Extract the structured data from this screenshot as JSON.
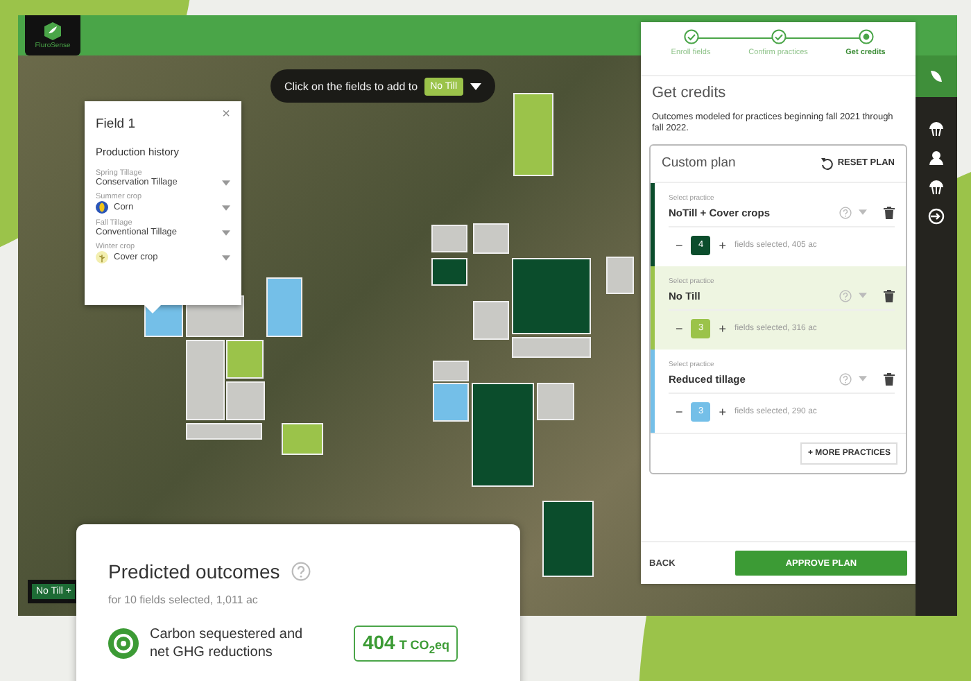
{
  "app": {
    "logo_text": "FluroSense"
  },
  "map": {
    "banner": {
      "text": "Click on the fields to add to",
      "chip": "No Till"
    },
    "legend_chip": "No Till +",
    "fields": [
      {
        "color": "#9bc34a"
      },
      {
        "color": "#74bfe8"
      },
      {
        "color": "#c9c9c5"
      },
      {
        "color": "#74bfe8"
      },
      {
        "color": "#9bc34a"
      },
      {
        "color": "#c9c9c5"
      },
      {
        "color": "#c9c9c5"
      },
      {
        "color": "#c9c9c5"
      },
      {
        "color": "#9bc34a"
      },
      {
        "color": "#c9c9c5"
      },
      {
        "color": "#c9c9c5"
      },
      {
        "color": "#0b4d2c"
      },
      {
        "color": "#c9c9c5"
      },
      {
        "color": "#0b4d2c"
      },
      {
        "color": "#c9c9c5"
      },
      {
        "color": "#c9c9c5"
      },
      {
        "color": "#74bfe8"
      },
      {
        "color": "#0b4d2c"
      },
      {
        "color": "#c9c9c5"
      },
      {
        "color": "#0b4d2c"
      },
      {
        "color": "#c9c9c5"
      }
    ]
  },
  "popup": {
    "title": "Field 1",
    "close": "×",
    "section": "Production history",
    "rows": [
      {
        "label": "Spring Tillage",
        "value": "Conservation Tillage",
        "kind": "plain"
      },
      {
        "label": "Summer crop",
        "value": "Corn",
        "kind": "corn"
      },
      {
        "label": "Fall Tillage",
        "value": "Conventional Tillage",
        "kind": "plain"
      },
      {
        "label": "Winter crop",
        "value": "Cover crop",
        "kind": "cover"
      }
    ]
  },
  "panel": {
    "steps": [
      {
        "label": "Enroll fields",
        "done": true,
        "selected": false
      },
      {
        "label": "Confirm practices",
        "done": true,
        "selected": false
      },
      {
        "label": "Get credits",
        "done": false,
        "selected": true
      }
    ],
    "title": "Get credits",
    "description": "Outcomes modeled for practices beginning fall 2021 through fall 2022.",
    "plan_title": "Custom plan",
    "reset": "RESET PLAN",
    "practices": [
      {
        "label": "Select practice",
        "name": "NoTill + Cover crops",
        "count": "4",
        "summary": "fields selected, 405 ac",
        "color": "#0b4d2c",
        "selected": false
      },
      {
        "label": "Select practice",
        "name": "No Till",
        "count": "3",
        "summary": "fields selected, 316 ac",
        "color": "#9bc34a",
        "selected": true
      },
      {
        "label": "Select practice",
        "name": "Reduced tillage",
        "count": "3",
        "summary": "fields selected, 290 ac",
        "color": "#74bfe8",
        "selected": false
      }
    ],
    "minus": "−",
    "plus": "+",
    "more": "+ MORE PRACTICES",
    "back": "BACK",
    "approve": "APPROVE PLAN"
  },
  "outcomes": {
    "title": "Predicted outcomes",
    "subtitle": "for 10 fields selected, 1,011 ac",
    "metric": "Carbon sequestered and net GHG reductions",
    "value": "404",
    "unit": "T CO$_{2}$eq"
  }
}
